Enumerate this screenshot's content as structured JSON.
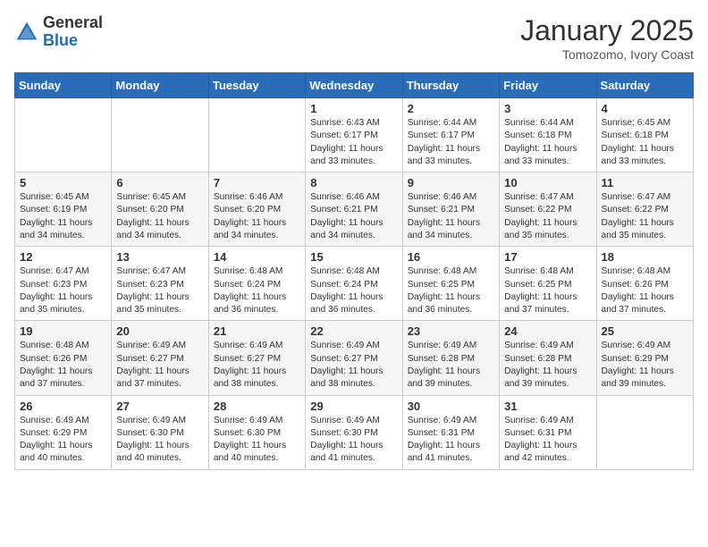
{
  "header": {
    "logo_line1": "General",
    "logo_line2": "Blue",
    "month": "January 2025",
    "location": "Tomozomo, Ivory Coast"
  },
  "weekdays": [
    "Sunday",
    "Monday",
    "Tuesday",
    "Wednesday",
    "Thursday",
    "Friday",
    "Saturday"
  ],
  "weeks": [
    [
      {
        "day": "",
        "info": ""
      },
      {
        "day": "",
        "info": ""
      },
      {
        "day": "",
        "info": ""
      },
      {
        "day": "1",
        "info": "Sunrise: 6:43 AM\nSunset: 6:17 PM\nDaylight: 11 hours\nand 33 minutes."
      },
      {
        "day": "2",
        "info": "Sunrise: 6:44 AM\nSunset: 6:17 PM\nDaylight: 11 hours\nand 33 minutes."
      },
      {
        "day": "3",
        "info": "Sunrise: 6:44 AM\nSunset: 6:18 PM\nDaylight: 11 hours\nand 33 minutes."
      },
      {
        "day": "4",
        "info": "Sunrise: 6:45 AM\nSunset: 6:18 PM\nDaylight: 11 hours\nand 33 minutes."
      }
    ],
    [
      {
        "day": "5",
        "info": "Sunrise: 6:45 AM\nSunset: 6:19 PM\nDaylight: 11 hours\nand 34 minutes."
      },
      {
        "day": "6",
        "info": "Sunrise: 6:45 AM\nSunset: 6:20 PM\nDaylight: 11 hours\nand 34 minutes."
      },
      {
        "day": "7",
        "info": "Sunrise: 6:46 AM\nSunset: 6:20 PM\nDaylight: 11 hours\nand 34 minutes."
      },
      {
        "day": "8",
        "info": "Sunrise: 6:46 AM\nSunset: 6:21 PM\nDaylight: 11 hours\nand 34 minutes."
      },
      {
        "day": "9",
        "info": "Sunrise: 6:46 AM\nSunset: 6:21 PM\nDaylight: 11 hours\nand 34 minutes."
      },
      {
        "day": "10",
        "info": "Sunrise: 6:47 AM\nSunset: 6:22 PM\nDaylight: 11 hours\nand 35 minutes."
      },
      {
        "day": "11",
        "info": "Sunrise: 6:47 AM\nSunset: 6:22 PM\nDaylight: 11 hours\nand 35 minutes."
      }
    ],
    [
      {
        "day": "12",
        "info": "Sunrise: 6:47 AM\nSunset: 6:23 PM\nDaylight: 11 hours\nand 35 minutes."
      },
      {
        "day": "13",
        "info": "Sunrise: 6:47 AM\nSunset: 6:23 PM\nDaylight: 11 hours\nand 35 minutes."
      },
      {
        "day": "14",
        "info": "Sunrise: 6:48 AM\nSunset: 6:24 PM\nDaylight: 11 hours\nand 36 minutes."
      },
      {
        "day": "15",
        "info": "Sunrise: 6:48 AM\nSunset: 6:24 PM\nDaylight: 11 hours\nand 36 minutes."
      },
      {
        "day": "16",
        "info": "Sunrise: 6:48 AM\nSunset: 6:25 PM\nDaylight: 11 hours\nand 36 minutes."
      },
      {
        "day": "17",
        "info": "Sunrise: 6:48 AM\nSunset: 6:25 PM\nDaylight: 11 hours\nand 37 minutes."
      },
      {
        "day": "18",
        "info": "Sunrise: 6:48 AM\nSunset: 6:26 PM\nDaylight: 11 hours\nand 37 minutes."
      }
    ],
    [
      {
        "day": "19",
        "info": "Sunrise: 6:48 AM\nSunset: 6:26 PM\nDaylight: 11 hours\nand 37 minutes."
      },
      {
        "day": "20",
        "info": "Sunrise: 6:49 AM\nSunset: 6:27 PM\nDaylight: 11 hours\nand 37 minutes."
      },
      {
        "day": "21",
        "info": "Sunrise: 6:49 AM\nSunset: 6:27 PM\nDaylight: 11 hours\nand 38 minutes."
      },
      {
        "day": "22",
        "info": "Sunrise: 6:49 AM\nSunset: 6:27 PM\nDaylight: 11 hours\nand 38 minutes."
      },
      {
        "day": "23",
        "info": "Sunrise: 6:49 AM\nSunset: 6:28 PM\nDaylight: 11 hours\nand 39 minutes."
      },
      {
        "day": "24",
        "info": "Sunrise: 6:49 AM\nSunset: 6:28 PM\nDaylight: 11 hours\nand 39 minutes."
      },
      {
        "day": "25",
        "info": "Sunrise: 6:49 AM\nSunset: 6:29 PM\nDaylight: 11 hours\nand 39 minutes."
      }
    ],
    [
      {
        "day": "26",
        "info": "Sunrise: 6:49 AM\nSunset: 6:29 PM\nDaylight: 11 hours\nand 40 minutes."
      },
      {
        "day": "27",
        "info": "Sunrise: 6:49 AM\nSunset: 6:30 PM\nDaylight: 11 hours\nand 40 minutes."
      },
      {
        "day": "28",
        "info": "Sunrise: 6:49 AM\nSunset: 6:30 PM\nDaylight: 11 hours\nand 40 minutes."
      },
      {
        "day": "29",
        "info": "Sunrise: 6:49 AM\nSunset: 6:30 PM\nDaylight: 11 hours\nand 41 minutes."
      },
      {
        "day": "30",
        "info": "Sunrise: 6:49 AM\nSunset: 6:31 PM\nDaylight: 11 hours\nand 41 minutes."
      },
      {
        "day": "31",
        "info": "Sunrise: 6:49 AM\nSunset: 6:31 PM\nDaylight: 11 hours\nand 42 minutes."
      },
      {
        "day": "",
        "info": ""
      }
    ]
  ]
}
